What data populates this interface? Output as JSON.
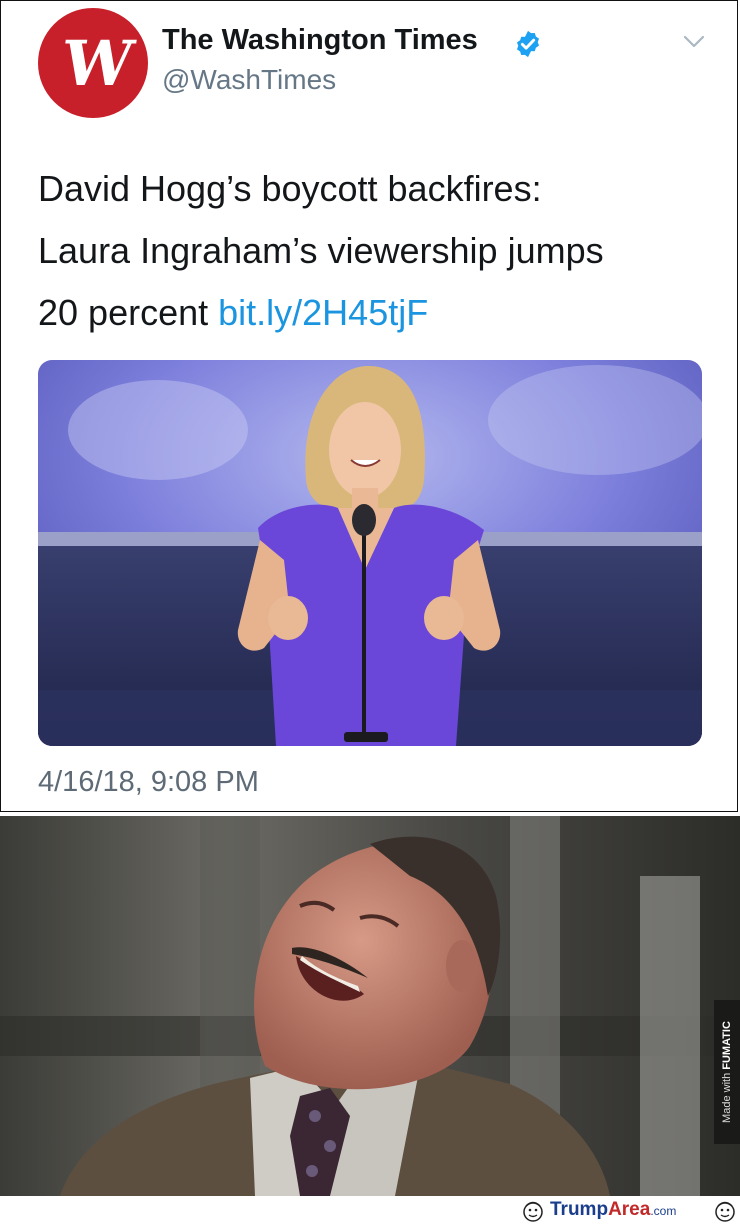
{
  "tweet": {
    "display_name": "The Washington Times",
    "handle": "@WashTimes",
    "avatar_letter": "W",
    "verified": true,
    "text_lines": [
      "David Hogg’s boycott backfires:",
      "Laura Ingraham’s viewership jumps",
      "20 percent"
    ],
    "link": "bit.ly/2H45tjF",
    "timestamp": "4/16/18, 9:08 PM",
    "icons": {
      "verified": "verified-badge-icon",
      "menu": "chevron-down-icon"
    }
  },
  "meme": {
    "watermark_prefix": "Made with",
    "watermark_brand": "FUMATIC"
  },
  "footer": {
    "site_main": "Trump",
    "site_accent": "Area",
    "site_suffix": ".com"
  },
  "colors": {
    "brand_red": "#c8202a",
    "link_blue": "#1b95e0",
    "verified_blue": "#1da1f2",
    "handle_gray": "#657786"
  }
}
